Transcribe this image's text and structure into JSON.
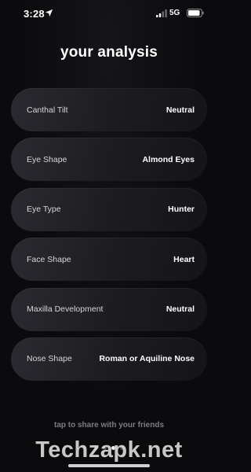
{
  "status_bar": {
    "time": "3:28",
    "network": "5G",
    "icons": [
      "location-arrow-icon",
      "signal-bars-icon",
      "battery-icon"
    ]
  },
  "header": {
    "title": "your analysis"
  },
  "analysis": {
    "items": [
      {
        "label": "Canthal Tilt",
        "value": "Neutral"
      },
      {
        "label": "Eye Shape",
        "value": "Almond Eyes"
      },
      {
        "label": "Eye Type",
        "value": "Hunter"
      },
      {
        "label": "Face Shape",
        "value": "Heart"
      },
      {
        "label": "Maxilla Development",
        "value": "Neutral"
      },
      {
        "label": "Nose Shape",
        "value": "Roman or Aquiline Nose"
      }
    ]
  },
  "footer": {
    "share_hint": "tap to share with your friends",
    "pagination": {
      "total": 4,
      "current": 3
    }
  },
  "watermark": "Techzapk.net",
  "colors": {
    "background": "#0b0b0d",
    "card": "#222227",
    "text": "#ffffff",
    "muted": "#7c7c84"
  }
}
